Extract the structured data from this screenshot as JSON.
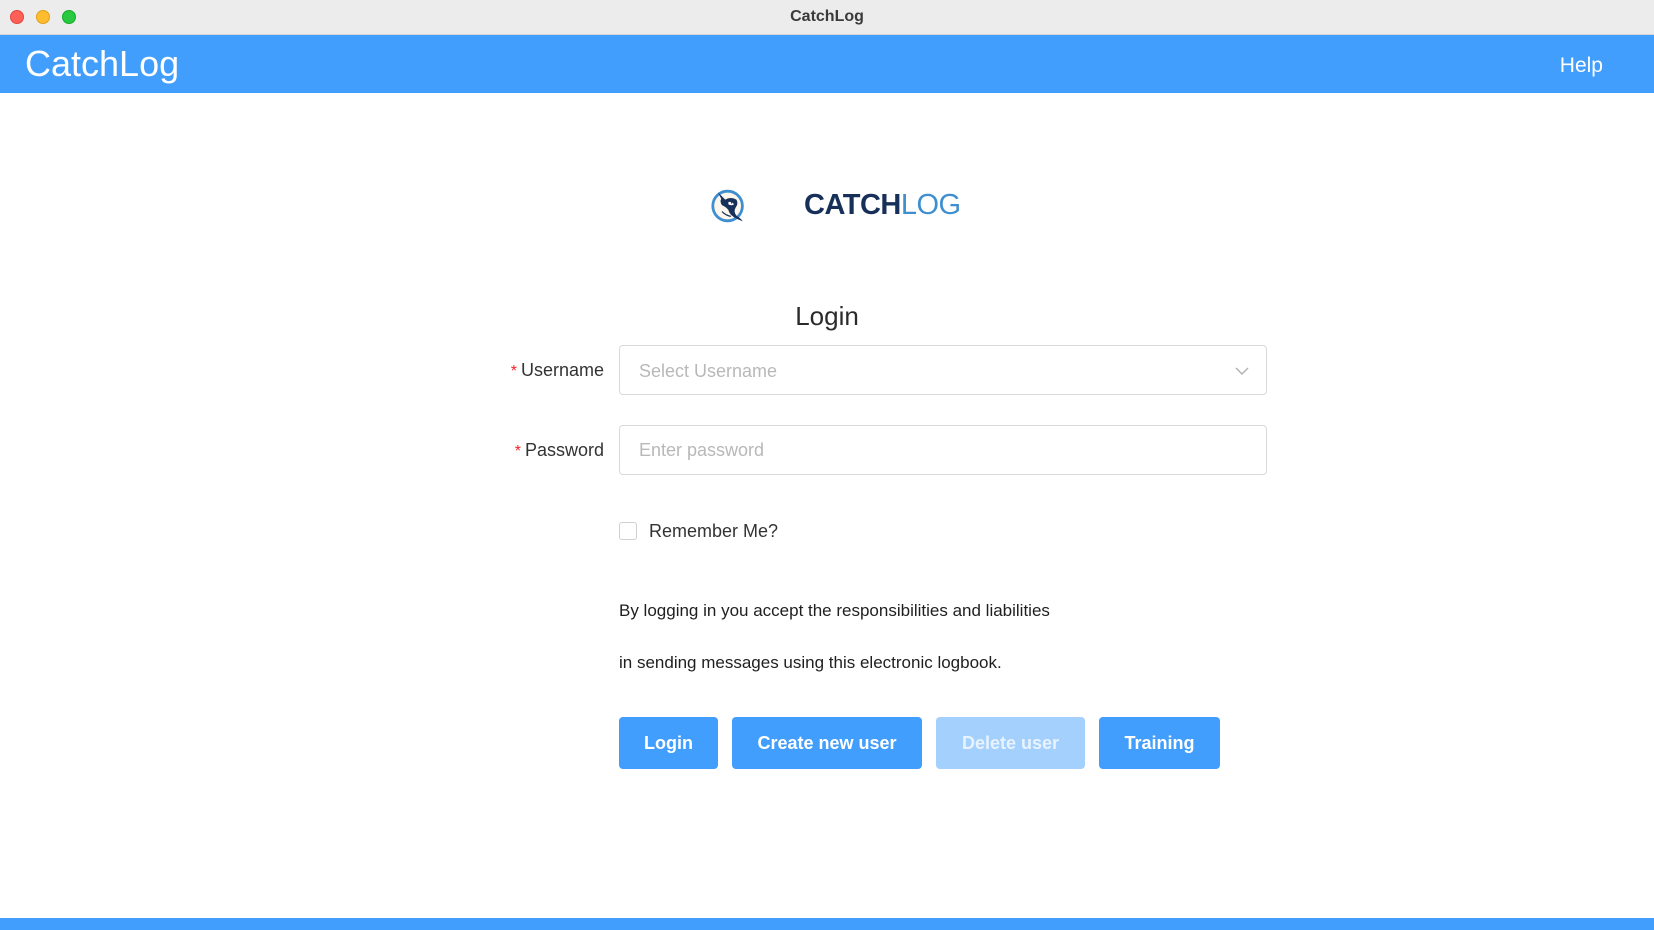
{
  "window": {
    "title": "CatchLog"
  },
  "header": {
    "app_title": "CatchLog",
    "help_label": "Help"
  },
  "logo": {
    "text_part1": "CATCH",
    "text_part2": "LOG"
  },
  "form": {
    "heading": "Login",
    "required_marker": "*",
    "username_label": "Username",
    "username_placeholder": "Select Username",
    "password_label": "Password",
    "password_placeholder": "Enter password",
    "remember_label": "Remember Me?",
    "remember_checked": false
  },
  "notice": {
    "line1": "By logging in you accept the responsibilities and liabilities",
    "line2": "in sending messages using this electronic logbook."
  },
  "buttons": {
    "login": "Login",
    "create_user": "Create new user",
    "delete_user": "Delete user",
    "training": "Training"
  },
  "colors": {
    "primary": "#429efc",
    "primary_disabled": "#a3d0fd",
    "required": "#f5222d",
    "logo_dark": "#17305a",
    "logo_light": "#3f8fd0"
  }
}
